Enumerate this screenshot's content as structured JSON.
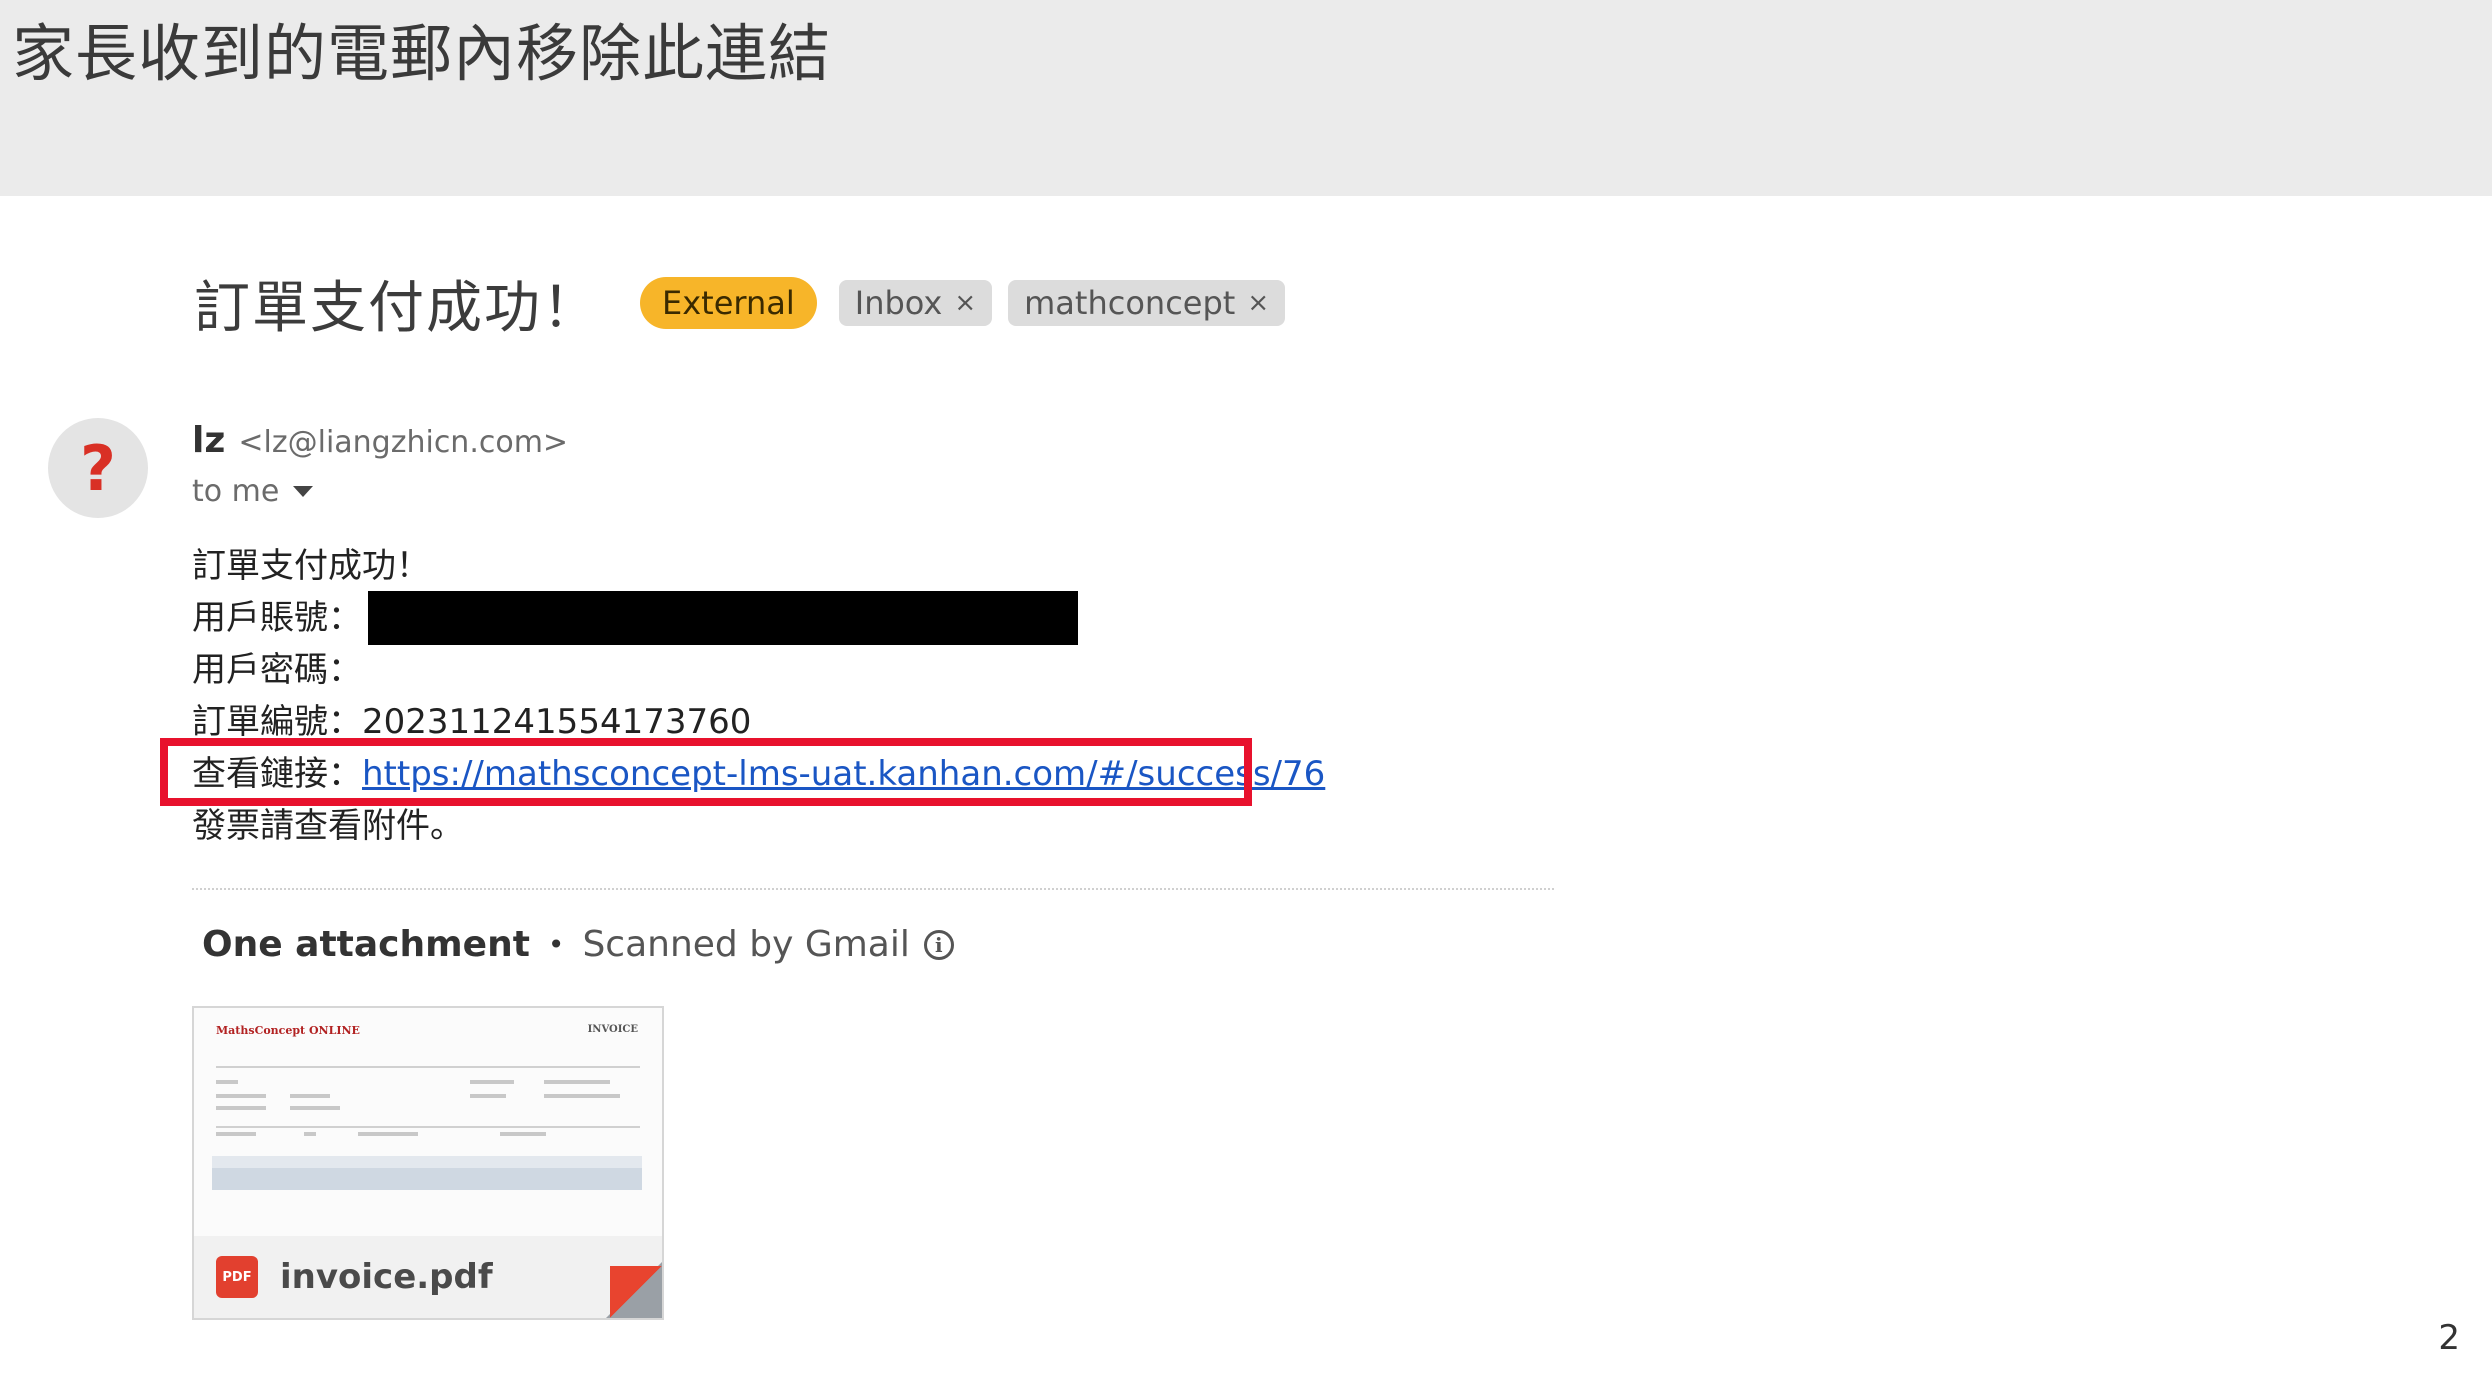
{
  "slide": {
    "title": "家長收到的電郵內移除此連結",
    "page_number": "2"
  },
  "email": {
    "subject": "訂單支付成功！",
    "labels": {
      "external": "External",
      "inbox": "Inbox",
      "mathconcept": "mathconcept",
      "remove_glyph": "×"
    },
    "avatar_glyph": "?",
    "sender_name": "lz",
    "sender_email": "<lz@liangzhicn.com>",
    "recipient": "to me",
    "body": {
      "line1": "訂單支付成功！",
      "account_label": "用戶賬號：",
      "password_label": "用戶密碼：",
      "order_label": "訂單編號：",
      "order_number": "202311241554173760",
      "link_label": "查看鏈接：",
      "link_url": "https://mathsconcept-lms-uat.kanhan.com/#/success/76",
      "invoice_note": "發票請查看附件。"
    }
  },
  "attachments": {
    "count_label": "One attachment",
    "separator": "•",
    "scanned_label": "Scanned by Gmail",
    "info_glyph": "i",
    "file": {
      "name": "invoice.pdf",
      "type_badge": "PDF",
      "thumb_logo": "MathsConcept ONLINE",
      "thumb_heading": "INVOICE"
    }
  },
  "colors": {
    "highlight_border": "#e8112d",
    "link": "#1a56c4",
    "external_chip": "#f7b529",
    "pdf_red": "#e2402f"
  }
}
